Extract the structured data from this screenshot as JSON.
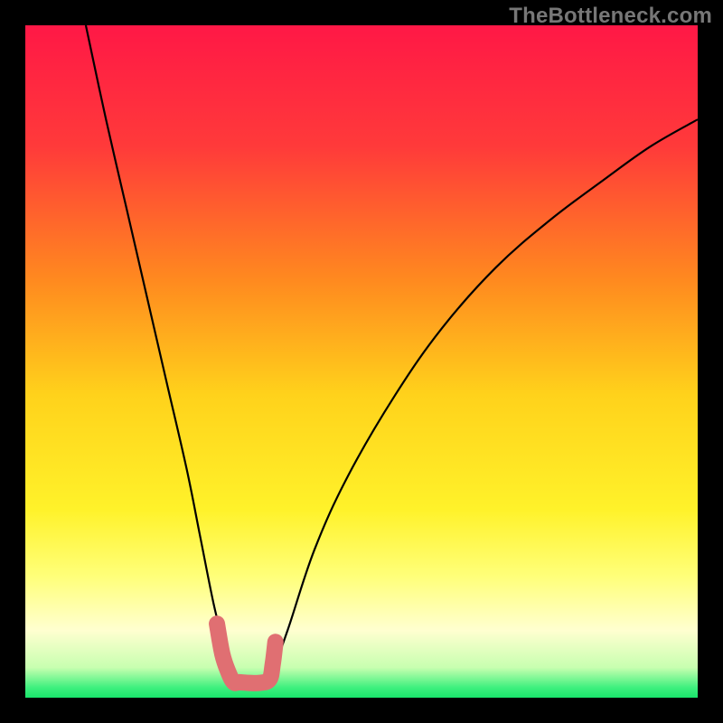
{
  "watermark": "TheBottleneck.com",
  "chart_data": {
    "type": "line",
    "title": "",
    "xlabel": "",
    "ylabel": "",
    "xlim": [
      0,
      100
    ],
    "ylim": [
      0,
      100
    ],
    "grid": false,
    "legend": false,
    "gradient_stops": [
      {
        "offset": 0.0,
        "color": "#ff1846"
      },
      {
        "offset": 0.18,
        "color": "#ff3a3a"
      },
      {
        "offset": 0.38,
        "color": "#ff8a1f"
      },
      {
        "offset": 0.55,
        "color": "#ffd21b"
      },
      {
        "offset": 0.72,
        "color": "#fff22a"
      },
      {
        "offset": 0.82,
        "color": "#ffff7a"
      },
      {
        "offset": 0.9,
        "color": "#ffffd0"
      },
      {
        "offset": 0.955,
        "color": "#c8ffb0"
      },
      {
        "offset": 0.985,
        "color": "#3ef07e"
      },
      {
        "offset": 1.0,
        "color": "#19e56b"
      }
    ],
    "series": [
      {
        "name": "bottleneck-curve",
        "color": "#000000",
        "x": [
          9,
          12,
          15,
          18,
          21,
          24,
          26,
          28,
          29.5,
          30.5,
          31.5,
          33,
          35,
          36.7,
          39,
          43,
          48,
          55,
          62,
          70,
          78,
          86,
          93,
          100
        ],
        "y": [
          100,
          86,
          73,
          60,
          47,
          34,
          24,
          14,
          8,
          4,
          2.3,
          2.3,
          2.3,
          4,
          10,
          22,
          33,
          45,
          55,
          64,
          71,
          77,
          82,
          86
        ]
      },
      {
        "name": "highlight-marker",
        "color": "#e06f72",
        "style": "thick-round",
        "x": [
          28.5,
          29.3,
          30.2,
          31.0,
          31.8,
          33.2,
          34.8,
          36.3,
          36.8,
          37.2
        ],
        "y": [
          11.0,
          6.5,
          3.8,
          2.3,
          2.3,
          2.2,
          2.2,
          2.7,
          5.0,
          8.3
        ]
      }
    ]
  }
}
